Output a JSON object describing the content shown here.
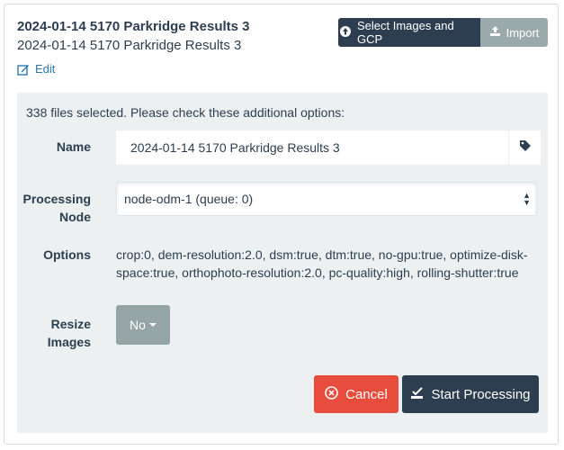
{
  "header": {
    "title": "2024-01-14 5170 Parkridge Results 3",
    "subtitle": "2024-01-14 5170 Parkridge Results 3",
    "edit_label": "Edit",
    "select_images_label": "Select Images and GCP",
    "import_label": "Import"
  },
  "form": {
    "notice": "338 files selected. Please check these additional options:",
    "name_label": "Name",
    "name_value": "2024-01-14 5170 Parkridge Results 3",
    "processing_node_label_line1": "Processing",
    "processing_node_label_line2": "Node",
    "processing_node_value": "node-odm-1 (queue: 0)",
    "options_label": "Options",
    "options_value": "crop:0, dem-resolution:2.0, dsm:true, dtm:true, no-gpu:true, optimize-disk-space:true, orthophoto-resolution:2.0, pc-quality:high, rolling-shutter:true",
    "resize_label_line1": "Resize",
    "resize_label_line2": "Images",
    "resize_value": "No",
    "cancel_label": "Cancel",
    "start_label": "Start Processing"
  },
  "colors": {
    "primary": "#2c3e50",
    "muted": "#95a5a6",
    "danger": "#e74c3c",
    "link": "#2a7ab0",
    "panel_bg": "#ecf0f1"
  },
  "icons": {
    "edit": "edit-icon",
    "upload": "upload-icon",
    "import": "import-icon",
    "tag": "tag-icon",
    "cancel": "cancel-circle-icon",
    "start": "check-square-icon"
  }
}
